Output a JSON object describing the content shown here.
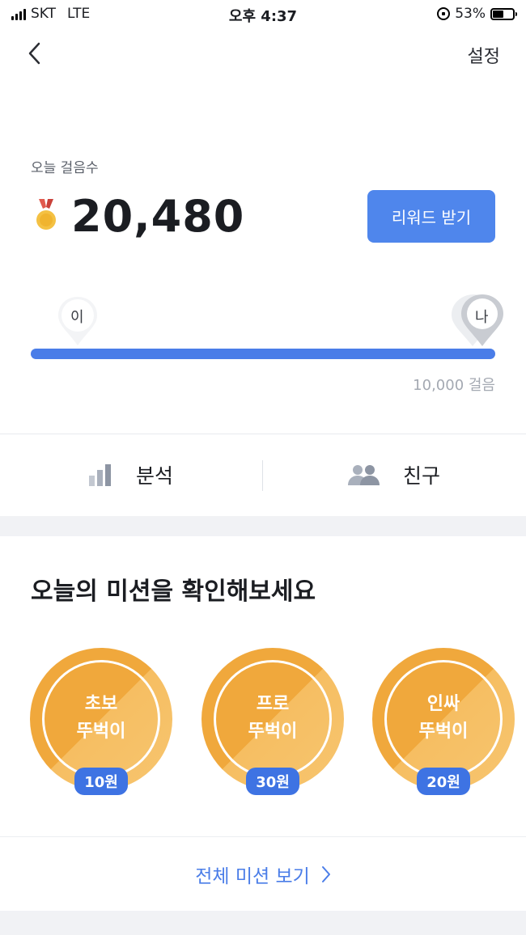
{
  "status_bar": {
    "carrier": "SKT",
    "network": "LTE",
    "time": "오후 4:37",
    "battery": "53%",
    "battery_level": 0.53
  },
  "nav": {
    "settings_label": "설정"
  },
  "steps": {
    "label": "오늘 걸음수",
    "count": "20,480",
    "reward_button": "리워드 받기",
    "marker_other": "이",
    "marker_me": "나",
    "goal_label": "10,000 걸음",
    "progress": 1.0,
    "medal_icon": "medal-icon"
  },
  "tabs": [
    {
      "label": "분석",
      "icon": "bar-chart-icon"
    },
    {
      "label": "친구",
      "icon": "people-icon"
    }
  ],
  "missions": {
    "title": "오늘의 미션을 확인해보세요",
    "items": [
      {
        "line1": "초보",
        "line2": "뚜벅이",
        "reward": "10원"
      },
      {
        "line1": "프로",
        "line2": "뚜벅이",
        "reward": "30원"
      },
      {
        "line1": "인싸",
        "line2": "뚜벅이",
        "reward": "20원"
      }
    ],
    "view_all": "전체 미션 보기"
  },
  "colors": {
    "accent": "#4a7de8",
    "badge_orange": "#f0a83c",
    "reward_blue": "#3e73e3"
  }
}
